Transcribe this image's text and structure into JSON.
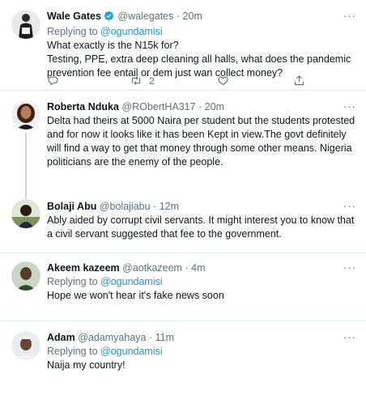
{
  "tweets": [
    {
      "name": "Wale Gates",
      "handle": "@walegates",
      "time": "20m",
      "verified": true,
      "replying_prefix": "Replying to",
      "replying_handle": "@ogundamisi",
      "text": "What exactly is the N15k for?\nTesting, PPE, extra deep cleaning all halls, what does the pandemic prevention fee entail or dem just wan collect money?",
      "retweet_count": "2"
    },
    {
      "name": "Roberta Nduka",
      "handle": "@RObertHA317",
      "time": "20m",
      "text": "Delta had theirs at 5000 Naira per student but the students protested and for now it looks like it has been Kept in view.The govt definitely will find a way to get that money through some other means. Nigeria politicians are the enemy of the people."
    },
    {
      "name": "Bolaji Abu",
      "handle": "@bolajiabu",
      "time": "12m",
      "text": "Ably aided by corrupt civil servants.  It might interest you to know that a civil servant suggested that fee to the government."
    },
    {
      "name": "Akeem kazeem",
      "handle": "@aotkazeem",
      "time": "4m",
      "replying_prefix": "Replying to",
      "replying_handle": "@ogundamisi",
      "text": "Hope we won't hear it's fake news soon"
    },
    {
      "name": "Adam",
      "handle": "@adamyahaya",
      "time": "11m",
      "replying_prefix": "Replying to",
      "replying_handle": "@ogundamisi",
      "text": "Naija my country!"
    }
  ],
  "separator": "·",
  "more_glyph": "···",
  "colors": {
    "accent": "#1b95e0",
    "muted": "#5b7083",
    "divider": "#e1e8ed",
    "thread_line": "#cfd9de"
  },
  "icons": [
    "verified-badge-icon",
    "reply-icon",
    "retweet-icon",
    "like-icon",
    "share-icon",
    "more-icon"
  ]
}
